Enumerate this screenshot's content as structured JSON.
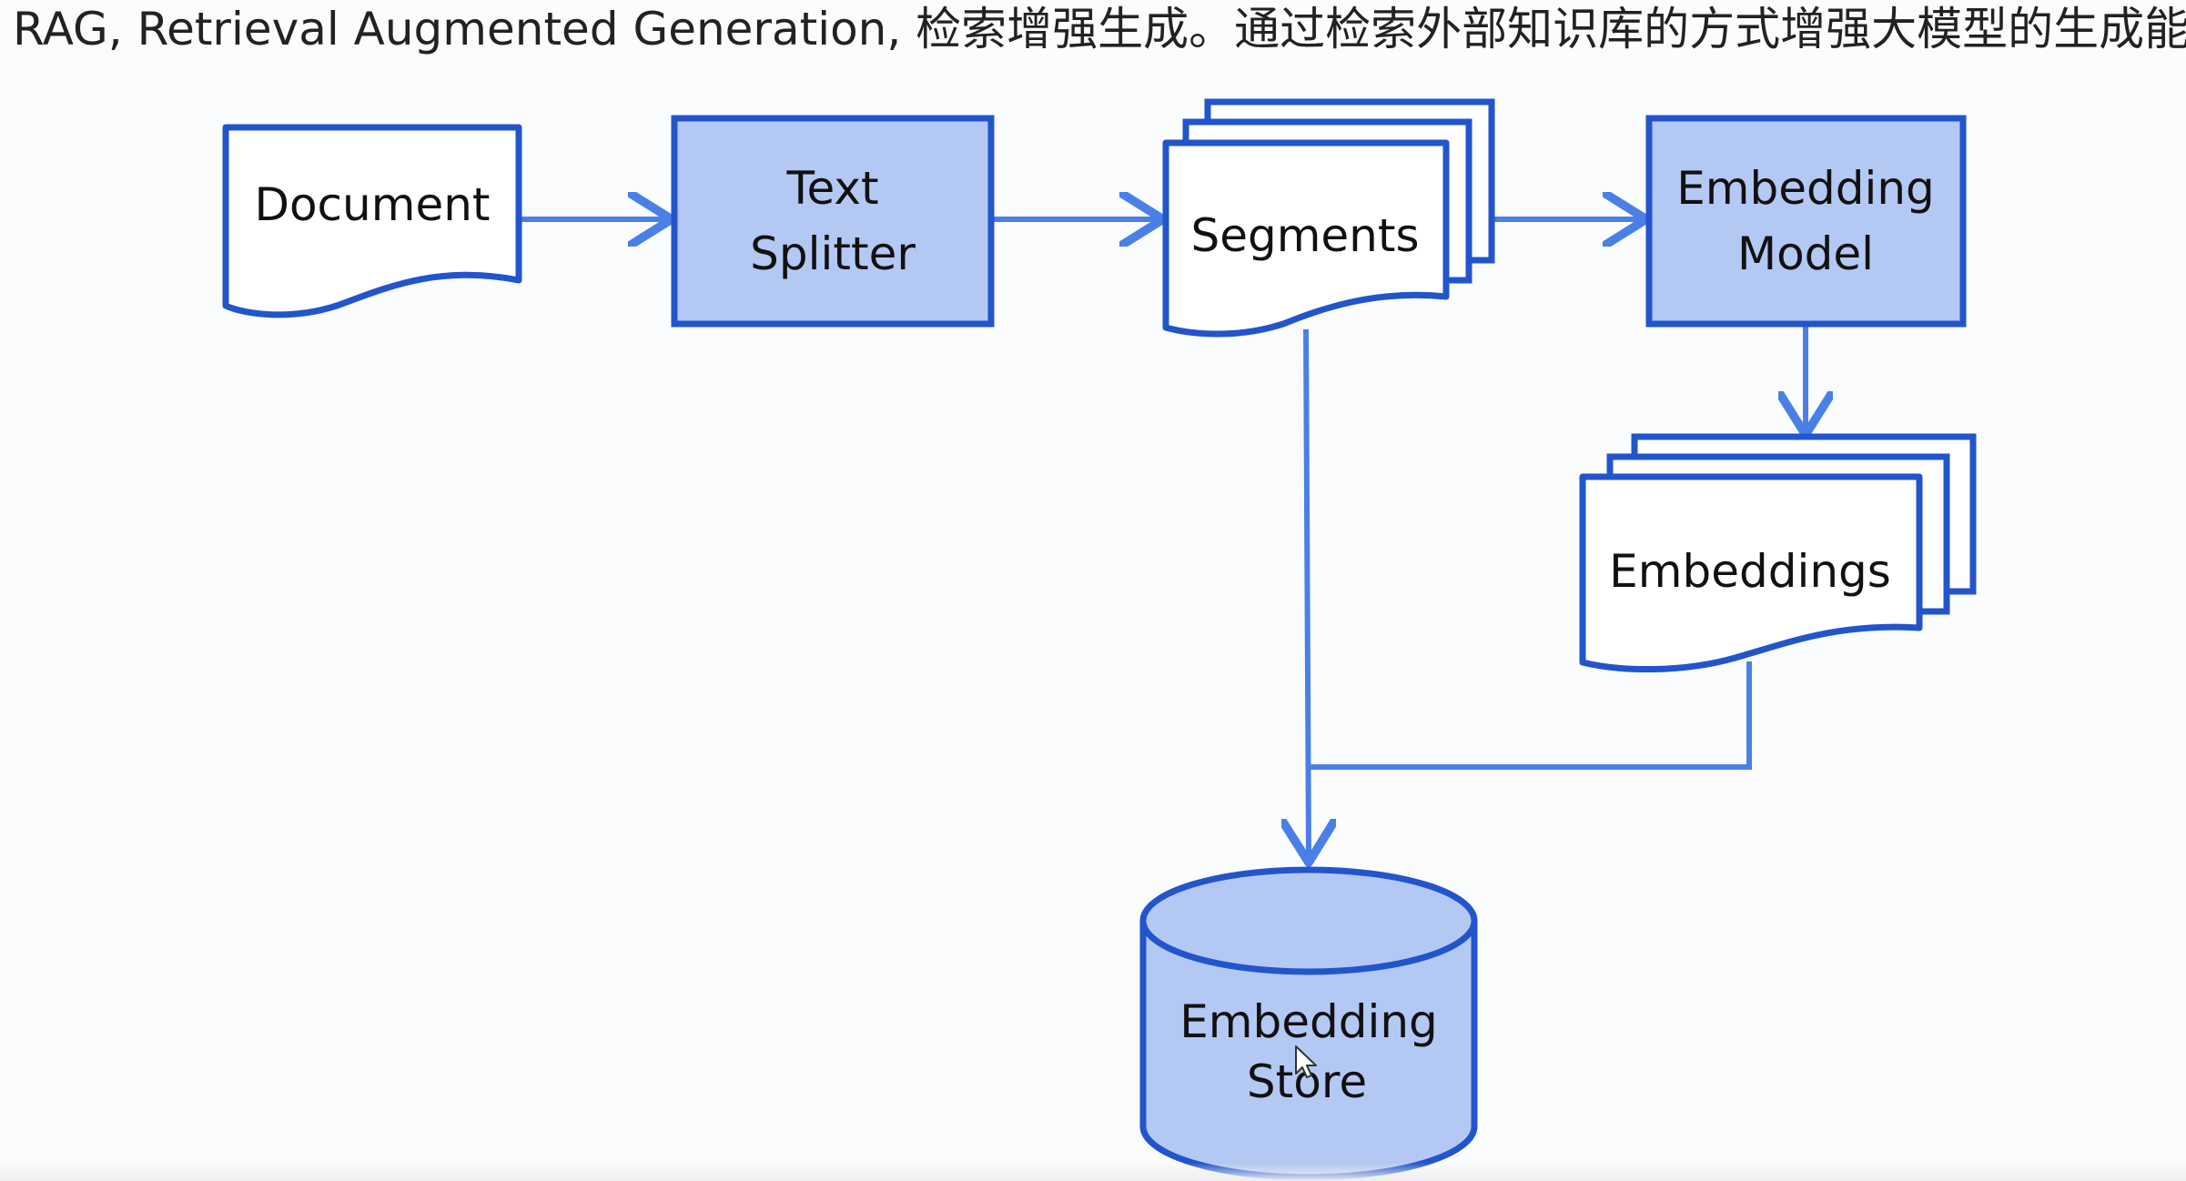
{
  "header": {
    "title": "RAG, Retrieval Augmented Generation, 检索增强生成。通过检索外部知识库的方式增强大模型的生成能力"
  },
  "colors": {
    "stroke": "#2255cc",
    "fill": "#b4c8f4",
    "arrow": "#4a80e6",
    "page_white": "#ffffff"
  },
  "nodes": {
    "document": {
      "label": "Document"
    },
    "text_splitter": {
      "line1": "Text",
      "line2": "Splitter"
    },
    "segments": {
      "label": "Segments"
    },
    "embedding_model": {
      "line1": "Embedding",
      "line2": "Model"
    },
    "embeddings": {
      "label": "Embeddings"
    },
    "embedding_store": {
      "line1": "Embedding",
      "line2": "Store"
    }
  },
  "icons": {
    "cursor": "mouse-pointer-icon"
  }
}
